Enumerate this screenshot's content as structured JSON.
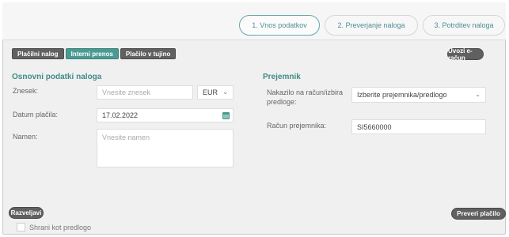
{
  "steps": [
    "1. Vnos podatkov",
    "2. Preverjanje naloga",
    "3. Potrditev naloga"
  ],
  "tabs": [
    "Plačilni nalog",
    "Interni prenos",
    "Plačilo v tujino"
  ],
  "import_button": "Uvozi e-račun",
  "left_section": {
    "title": "Osnovni podatki naloga",
    "amount_label": "Znesek:",
    "amount_placeholder": "Vnesite znesek",
    "currency": "EUR",
    "date_label": "Datum plačila:",
    "date_value": "17.02.2022",
    "purpose_label": "Namen:",
    "purpose_placeholder": "Vnesite namen"
  },
  "right_section": {
    "title": "Prejemnik",
    "template_label": "Nakazilo na račun/izbira predloge:",
    "template_select": "Izberite prejemnika/predlogo",
    "account_label": "Račun prejemnika:",
    "account_value": "SI5660000"
  },
  "footer": {
    "cancel_button": "Razveljavi",
    "verify_button": "Preveri plačilo",
    "save_template_label": "Shrani kot predlogo"
  },
  "colors": {
    "accent": "#4a9a92",
    "title": "#3f8a86",
    "dark_button": "#606060"
  }
}
